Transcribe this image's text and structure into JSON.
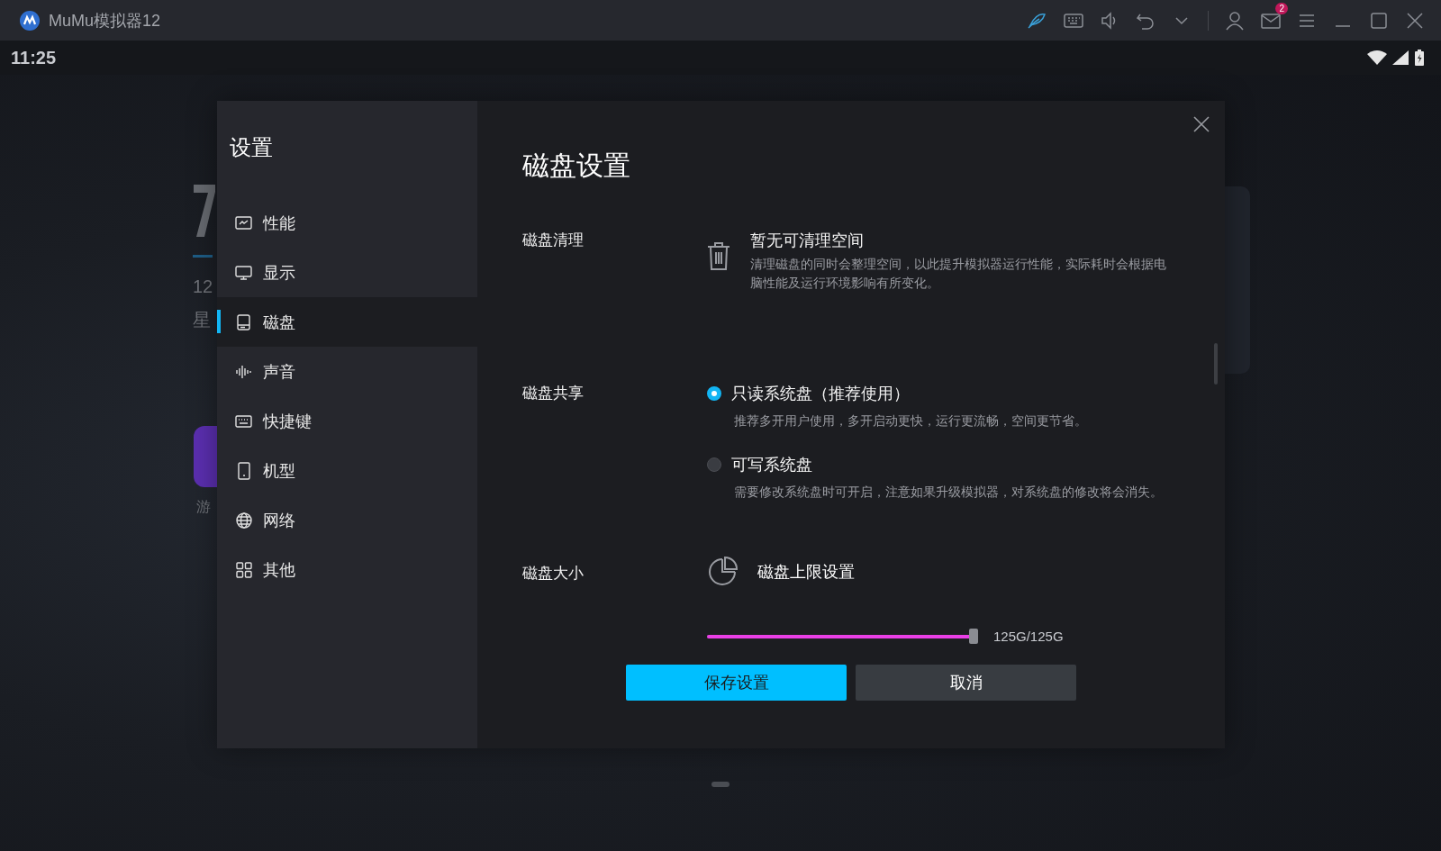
{
  "title_bar": {
    "app_name": "MuMu模拟器12",
    "mail_badge": "2"
  },
  "status_bar": {
    "time": "11:25"
  },
  "home": {
    "date": "12",
    "weekday": "星",
    "app_label": "游"
  },
  "settings": {
    "title": "设置",
    "items": [
      {
        "label": "性能",
        "selected": false
      },
      {
        "label": "显示",
        "selected": false
      },
      {
        "label": "磁盘",
        "selected": true
      },
      {
        "label": "声音",
        "selected": false
      },
      {
        "label": "快捷键",
        "selected": false
      },
      {
        "label": "机型",
        "selected": false
      },
      {
        "label": "网络",
        "selected": false
      },
      {
        "label": "其他",
        "selected": false
      }
    ]
  },
  "disk": {
    "title": "磁盘设置",
    "cleanup": {
      "label": "磁盘清理",
      "title": "暂无可清理空间",
      "description": "清理磁盘的同时会整理空间，以此提升模拟器运行性能，实际耗时会根据电脑性能及运行环境影响有所变化。"
    },
    "sharing": {
      "label": "磁盘共享",
      "options": [
        {
          "label": "只读系统盘（推荐使用）",
          "description": "推荐多开用户使用，多开启动更快，运行更流畅，空间更节省。",
          "selected": true
        },
        {
          "label": "可写系统盘",
          "description": "需要修改系统盘时可开启，注意如果升级模拟器，对系统盘的修改将会消失。",
          "selected": false
        }
      ]
    },
    "size": {
      "label": "磁盘大小",
      "title": "磁盘上限设置",
      "level": 1,
      "reading": "125G/125G"
    },
    "buttons": [
      {
        "label": "保存设置",
        "kind": "primary"
      },
      {
        "label": "取消",
        "kind": "secondary"
      }
    ]
  }
}
